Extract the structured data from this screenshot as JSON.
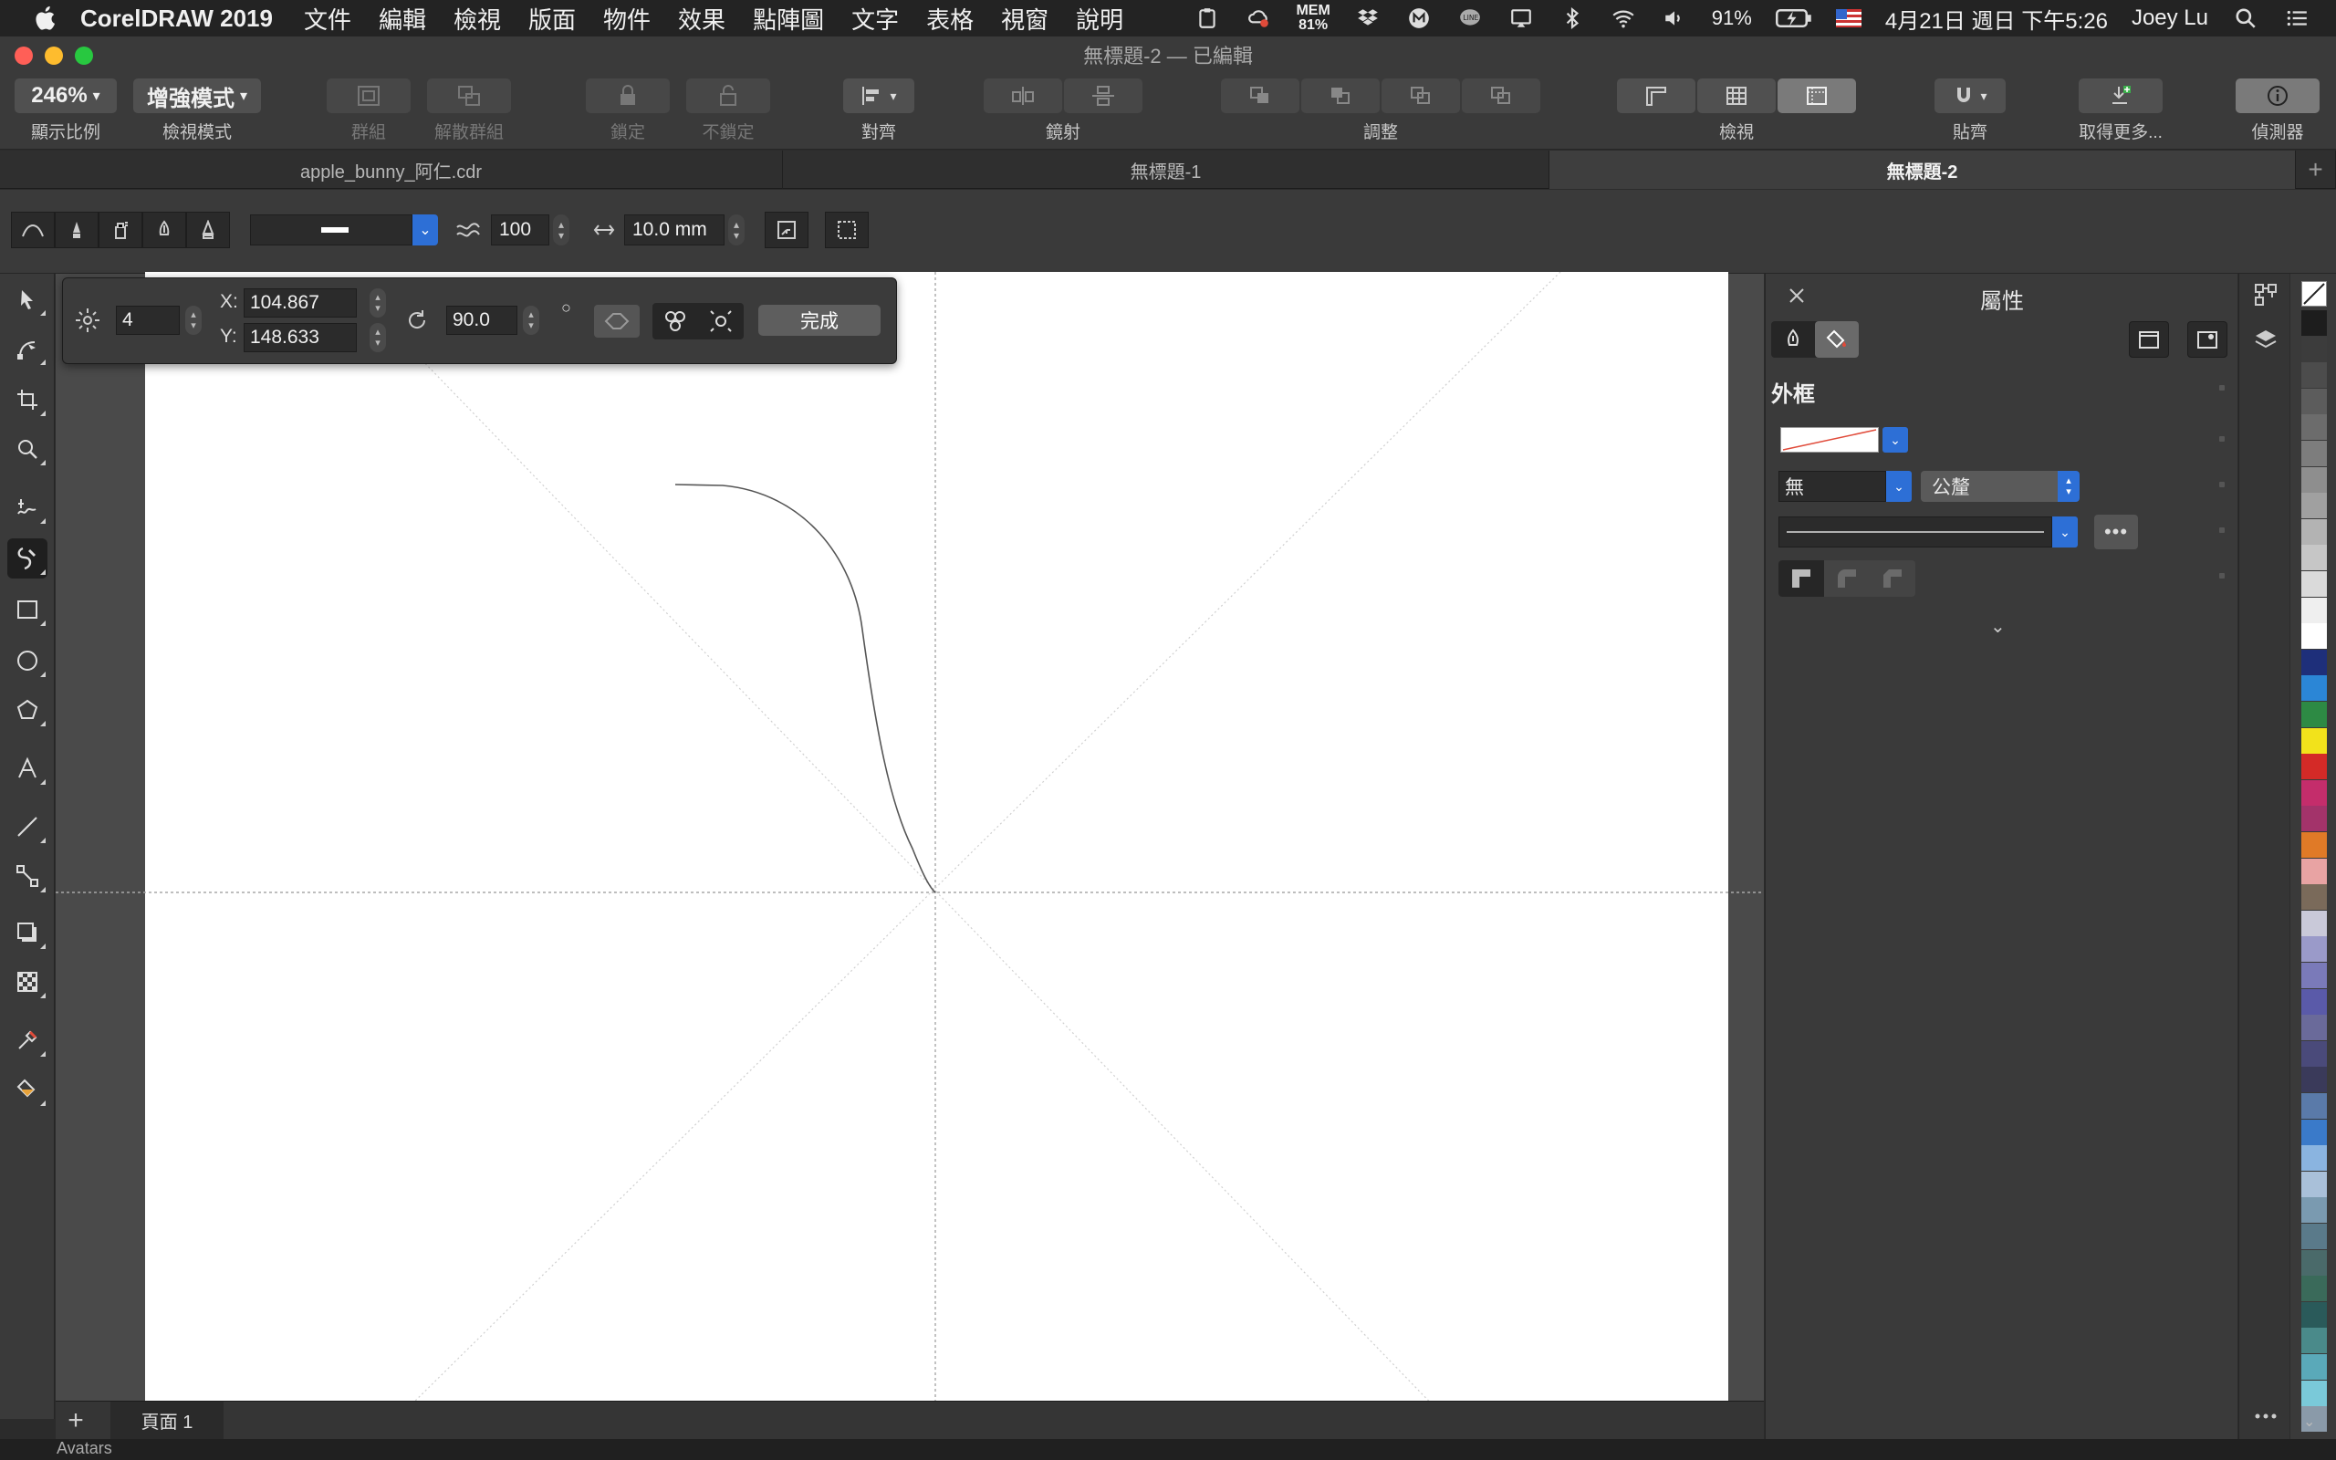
{
  "menubar": {
    "app_name": "CorelDRAW 2019",
    "menus": [
      "文件",
      "編輯",
      "檢視",
      "版面",
      "物件",
      "效果",
      "點陣圖",
      "文字",
      "表格",
      "視窗",
      "說明"
    ],
    "mem_label": "MEM",
    "mem_value": "81%",
    "battery": "91%",
    "datetime": "4月21日 週日 下午5:26",
    "user": "Joey Lu"
  },
  "window": {
    "title": "無標題-2 — 已編輯",
    "colors": {
      "close": "#ff5f57",
      "minimize": "#febc2e",
      "zoom": "#28c840"
    }
  },
  "toolbar": {
    "zoom_value": "246%",
    "zoom_label": "顯示比例",
    "view_mode_value": "增強模式",
    "view_mode_label": "檢視模式",
    "group_label": "群組",
    "ungroup_label": "解散群組",
    "lock_label": "鎖定",
    "unlock_label": "不鎖定",
    "align_label": "對齊",
    "mirror_label": "鏡射",
    "arrange_label": "調整",
    "view_label": "檢視",
    "snap_label": "貼齊",
    "get_more_label": "取得更多...",
    "inspector_label": "偵測器"
  },
  "tabs": [
    {
      "label": "apple_bunny_阿仁.cdr",
      "active": false
    },
    {
      "label": "無標題-1",
      "active": false
    },
    {
      "label": "無標題-2",
      "active": true
    }
  ],
  "propbar": {
    "smoothing_value": "100",
    "width_value": "10.0 mm"
  },
  "nodebar": {
    "points_value": "4",
    "x_label": "X:",
    "x_value": "104.867",
    "y_label": "Y:",
    "y_value": "148.633",
    "angle_value": "90.0",
    "done_label": "完成"
  },
  "pages": {
    "add_label": "+",
    "page1_label": "頁面 1",
    "status_peek": "Avatars"
  },
  "docker": {
    "title": "屬性",
    "section_outline": "外框",
    "outline_width_value": "無",
    "outline_unit_value": "公釐"
  },
  "palette": {
    "swatches": [
      "#1d1d1d",
      "#3c3c3c",
      "#4c4c4c",
      "#5c5c5c",
      "#6c6c6c",
      "#7d7d7d",
      "#8e8e8e",
      "#a0a0a0",
      "#b3b3b3",
      "#c6c6c6",
      "#dadada",
      "#efefef",
      "#ffffff",
      "#1e2f7a",
      "#2b86d6",
      "#2d8a44",
      "#f2e21b",
      "#d42a27",
      "#c42d6b",
      "#a3336a",
      "#e07a27",
      "#e8a3a3",
      "#7a6a5a",
      "#c9c9d9",
      "#9a9ac9",
      "#7a7ab9",
      "#5a5aa9",
      "#6a6a9a",
      "#4a4a7a",
      "#3a3a5a",
      "#5a7aa9",
      "#3a7ac9",
      "#8ab4e0",
      "#a9c0d9",
      "#7a9ab0",
      "#5a7a8a",
      "#4a6a6a",
      "#3a6a5a",
      "#2a5a5a",
      "#4a8a8a",
      "#5aa9b9",
      "#7ac9d9",
      "#8a9aa9"
    ]
  }
}
